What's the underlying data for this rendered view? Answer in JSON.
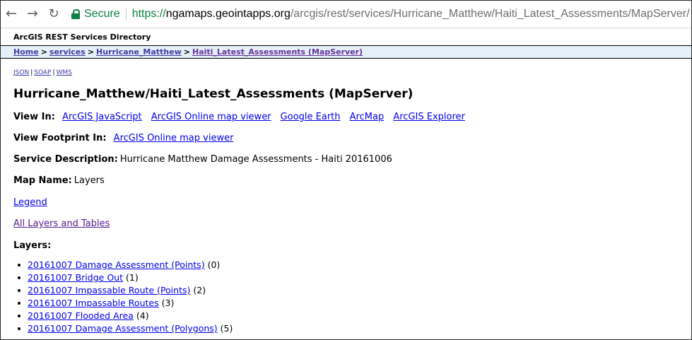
{
  "browser": {
    "secure_label": "Secure",
    "url_scheme": "https://",
    "url_host": "ngamaps.geointapps.org",
    "url_path": "/arcgis/rest/services/Hurricane_Matthew/Haiti_Latest_Assessments/MapServer/"
  },
  "header": {
    "title": "ArcGIS REST Services Directory"
  },
  "breadcrumb": {
    "items": [
      "Home",
      "services",
      "Hurricane_Matthew",
      "Haiti_Latest_Assessments (MapServer)"
    ],
    "separator": ">"
  },
  "formats": [
    "JSON",
    "SOAP",
    "WMS"
  ],
  "service": {
    "title": "Hurricane_Matthew/Haiti_Latest_Assessments (MapServer)",
    "view_in_label": "View In:",
    "view_in_links": [
      "ArcGIS JavaScript",
      "ArcGIS Online map viewer",
      "Google Earth",
      "ArcMap",
      "ArcGIS Explorer"
    ],
    "footprint_label": "View Footprint In:",
    "footprint_link": "ArcGIS Online map viewer",
    "description_label": "Service Description:",
    "description": "Hurricane Matthew Damage Assessments - Haiti 20161006",
    "map_name_label": "Map Name:",
    "map_name": "Layers",
    "legend_link": "Legend",
    "all_layers_link": "All Layers and Tables",
    "layers_label": "Layers:"
  },
  "layers": [
    {
      "name": "20161007 Damage Assessment (Points)",
      "count": "(0)"
    },
    {
      "name": "20161007 Bridge Out",
      "count": "(1)"
    },
    {
      "name": "20161007 Impassable Route (Points)",
      "count": "(2)"
    },
    {
      "name": "20161007 Impassable Routes",
      "count": "(3)"
    },
    {
      "name": "20161007 Flooded Area",
      "count": "(4)"
    },
    {
      "name": "20161007 Damage Assessment (Polygons)",
      "count": "(5)"
    }
  ],
  "colors": {
    "link": "#0000ee",
    "visited_link": "#551a8b",
    "breadcrumb_bg": "#e5eff7",
    "secure_green": "#0b8043"
  },
  "icons": [
    "back-arrow-icon",
    "forward-arrow-icon",
    "reload-icon",
    "lock-icon"
  ]
}
